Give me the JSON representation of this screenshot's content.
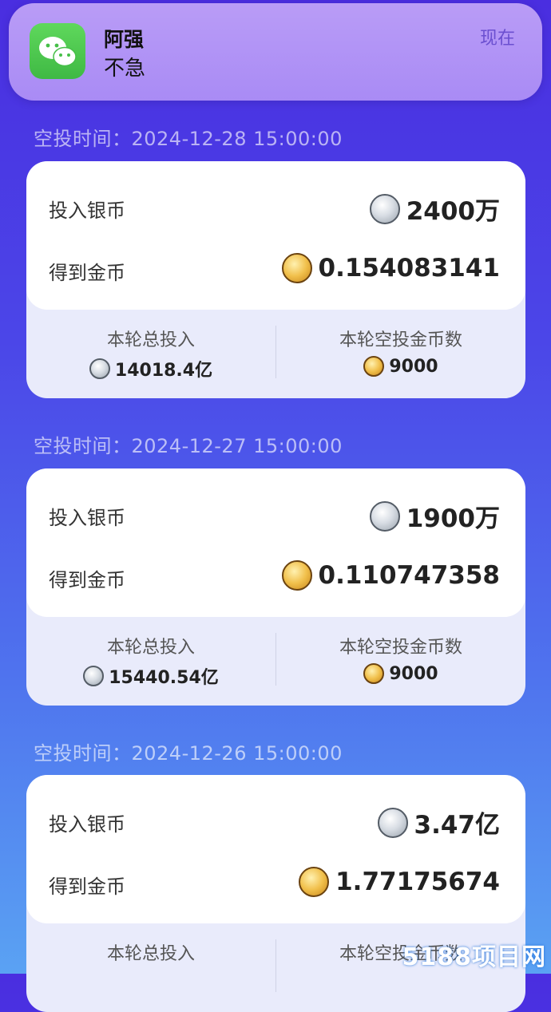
{
  "notification": {
    "title": "阿强",
    "body": "不急",
    "time": "现在",
    "app_icon": "wechat-icon"
  },
  "records": [
    {
      "airdrop_time": "空投时间：2024-12-28 15:00:00",
      "invest_label": "投入银币",
      "invest_value": "2400万",
      "earn_label": "得到金币",
      "earn_value": "0.154083141",
      "total_label": "本轮总投入",
      "total_value": "14018.4亿",
      "airdrop_label": "本轮空投金币数",
      "airdrop_value": "9000"
    },
    {
      "airdrop_time": "空投时间：2024-12-27 15:00:00",
      "invest_label": "投入银币",
      "invest_value": "1900万",
      "earn_label": "得到金币",
      "earn_value": "0.110747358",
      "total_label": "本轮总投入",
      "total_value": "15440.54亿",
      "airdrop_label": "本轮空投金币数",
      "airdrop_value": "9000"
    },
    {
      "airdrop_time": "空投时间：2024-12-26 15:00:00",
      "invest_label": "投入银币",
      "invest_value": "3.47亿",
      "earn_label": "得到金币",
      "earn_value": "1.77175674",
      "total_label": "本轮总投入",
      "total_value": "",
      "airdrop_label": "本轮空投金币数",
      "airdrop_value": ""
    }
  ],
  "watermark": "5188项目网",
  "colors": {
    "silver_coin": "#c9ced6",
    "gold_coin": "#f1c04c",
    "notification_bg": "#b19af6"
  }
}
